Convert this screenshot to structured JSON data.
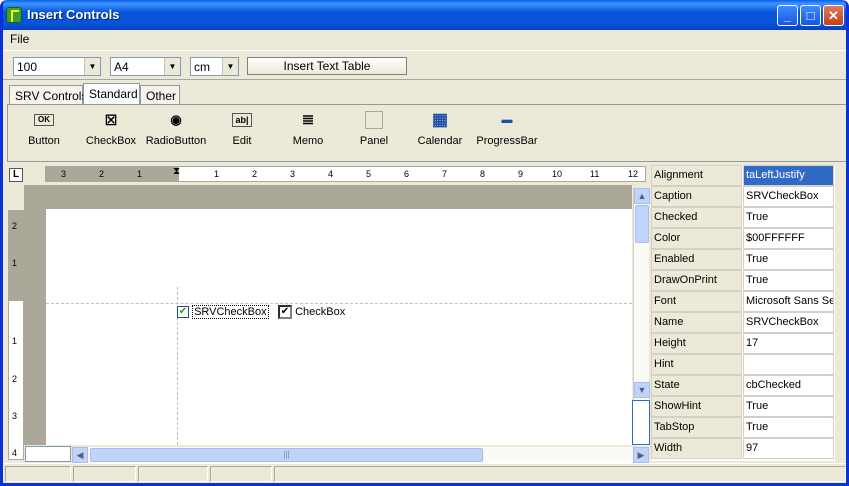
{
  "window": {
    "title": "Insert Controls"
  },
  "menu": {
    "file": "File"
  },
  "toolbar": {
    "zoom": "100",
    "paper": "A4",
    "unit": "cm",
    "insert_table": "Insert Text Table"
  },
  "tabs": [
    "SRV Controls",
    "Standard",
    "Other"
  ],
  "palette": [
    {
      "label": "Button",
      "icon": "button-icon",
      "glyph": "OK"
    },
    {
      "label": "CheckBox",
      "icon": "checkbox-icon",
      "glyph": "☒"
    },
    {
      "label": "RadioButton",
      "icon": "radiobutton-icon",
      "glyph": "◉"
    },
    {
      "label": "Edit",
      "icon": "edit-icon",
      "glyph": "ab|"
    },
    {
      "label": "Memo",
      "icon": "memo-icon",
      "glyph": "≣"
    },
    {
      "label": "Panel",
      "icon": "panel-icon",
      "glyph": ""
    },
    {
      "label": "Calendar",
      "icon": "calendar-icon",
      "glyph": "▦"
    },
    {
      "label": "ProgressBar",
      "icon": "progressbar-icon",
      "glyph": "▬"
    }
  ],
  "ruler_h": [
    "3",
    "2",
    "1",
    "1",
    "2",
    "3",
    "4",
    "5",
    "6",
    "7",
    "8",
    "9",
    "10",
    "11",
    "12"
  ],
  "ruler_v": [
    "2",
    "1",
    "1",
    "2",
    "3",
    "4"
  ],
  "document": {
    "srv_checkbox": "SRVCheckBox",
    "checkbox": "CheckBox"
  },
  "properties": [
    {
      "name": "Alignment",
      "value": "taLeftJustify"
    },
    {
      "name": "Caption",
      "value": "SRVCheckBox"
    },
    {
      "name": "Checked",
      "value": "True"
    },
    {
      "name": "Color",
      "value": "$00FFFFFF"
    },
    {
      "name": "Enabled",
      "value": "True"
    },
    {
      "name": "DrawOnPrint",
      "value": "True"
    },
    {
      "name": "Font",
      "value": "Microsoft Sans Serif"
    },
    {
      "name": "Name",
      "value": "SRVCheckBox"
    },
    {
      "name": "Height",
      "value": "17"
    },
    {
      "name": "Hint",
      "value": ""
    },
    {
      "name": "State",
      "value": "cbChecked"
    },
    {
      "name": "ShowHint",
      "value": "True"
    },
    {
      "name": "TabStop",
      "value": "True"
    },
    {
      "name": "Width",
      "value": "97"
    }
  ]
}
